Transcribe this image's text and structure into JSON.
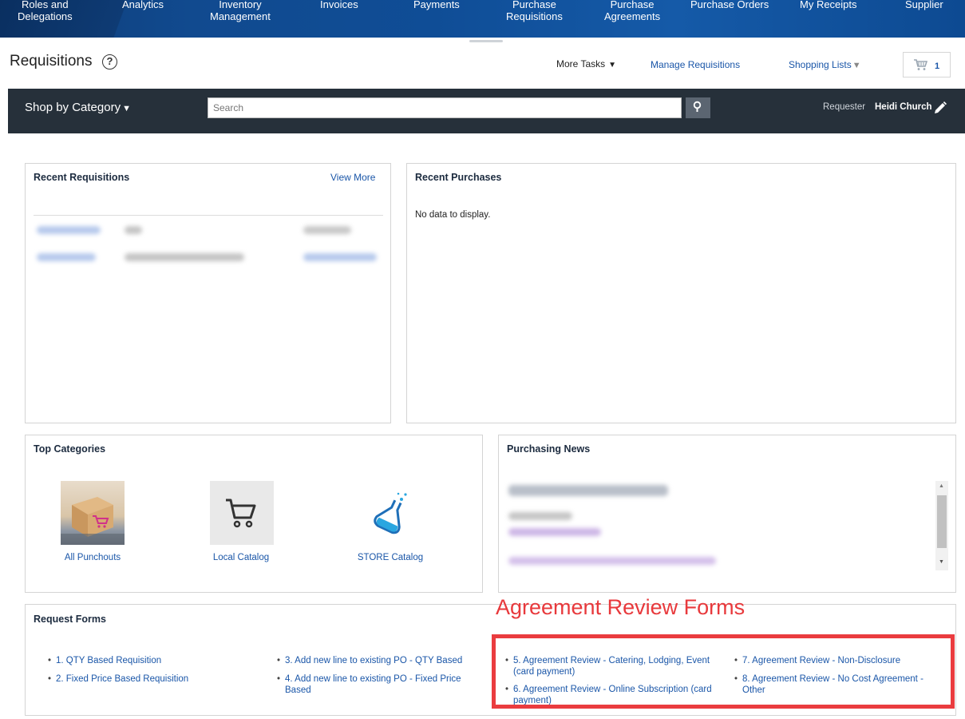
{
  "nav": {
    "items": [
      {
        "label": "Roles and\nDelegations"
      },
      {
        "label": "Analytics"
      },
      {
        "label": "Inventory\nManagement"
      },
      {
        "label": "Invoices"
      },
      {
        "label": "Payments"
      },
      {
        "label": "Purchase\nRequisitions"
      },
      {
        "label": "Purchase\nAgreements"
      },
      {
        "label": "Purchase Orders"
      },
      {
        "label": "My Receipts"
      },
      {
        "label": "Supplier"
      }
    ]
  },
  "header": {
    "title": "Requisitions",
    "help": "?",
    "more_tasks": "More Tasks",
    "manage_requisitions": "Manage Requisitions",
    "shopping_lists": "Shopping Lists",
    "cart_count": "1"
  },
  "search": {
    "shop_by_category": "Shop by Category",
    "placeholder": "Search",
    "requester_label": "Requester",
    "requester_name": "Heidi Church"
  },
  "recent_requisitions": {
    "title": "Recent Requisitions",
    "view_more": "View More"
  },
  "recent_purchases": {
    "title": "Recent Purchases",
    "empty": "No data to display."
  },
  "top_categories": {
    "title": "Top Categories",
    "items": [
      {
        "label": "All Punchouts",
        "icon": "punchout-box-icon"
      },
      {
        "label": "Local Catalog",
        "icon": "cart-icon"
      },
      {
        "label": "STORE Catalog",
        "icon": "flask-icon"
      }
    ]
  },
  "purchasing_news": {
    "title": "Purchasing News"
  },
  "request_forms": {
    "title": "Request Forms",
    "annotation": "Agreement Review Forms",
    "links": [
      {
        "label": "1. QTY Based Requisition"
      },
      {
        "label": "2. Fixed Price Based Requisition"
      },
      {
        "label": "3. Add new line to existing PO - QTY Based"
      },
      {
        "label": "4. Add new line to existing PO - Fixed Price Based"
      },
      {
        "label": "5. Agreement Review - Catering, Lodging, Event (card payment)"
      },
      {
        "label": "6. Agreement Review - Online Subscription (card payment)"
      },
      {
        "label": "7. Agreement Review - Non-Disclosure"
      },
      {
        "label": "8. Agreement Review - No Cost Agreement - Other"
      }
    ]
  },
  "colors": {
    "nav_blue": "#114a8f",
    "search_bar": "#26303a",
    "link": "#1a56a8",
    "annotation_red": "#e8393c"
  }
}
